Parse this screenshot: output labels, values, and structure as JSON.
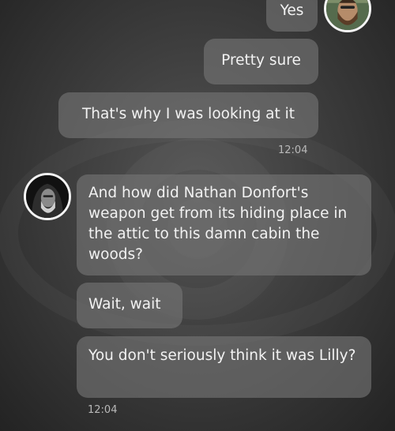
{
  "messages": {
    "outgoing": [
      {
        "text": "Yes"
      },
      {
        "text": "Pretty sure"
      },
      {
        "text": "That's why I was looking at it"
      }
    ],
    "outgoing_time": "12:04",
    "incoming": [
      {
        "text": "And how did Nathan Donfort's weapon get from its hiding place in the attic to this damn cabin the woods?"
      },
      {
        "text": "Wait, wait"
      },
      {
        "text": "You don't seriously think it was Lilly?"
      }
    ],
    "incoming_time": "12:04"
  },
  "avatars": {
    "me": "bearded-man-avatar",
    "other": "hooded-bearded-man-avatar"
  },
  "colors": {
    "bubble": "#7a7a7a",
    "text": "#f2f2f2",
    "timestamp": "#b9b9b9",
    "background": "#3e3e3e"
  }
}
